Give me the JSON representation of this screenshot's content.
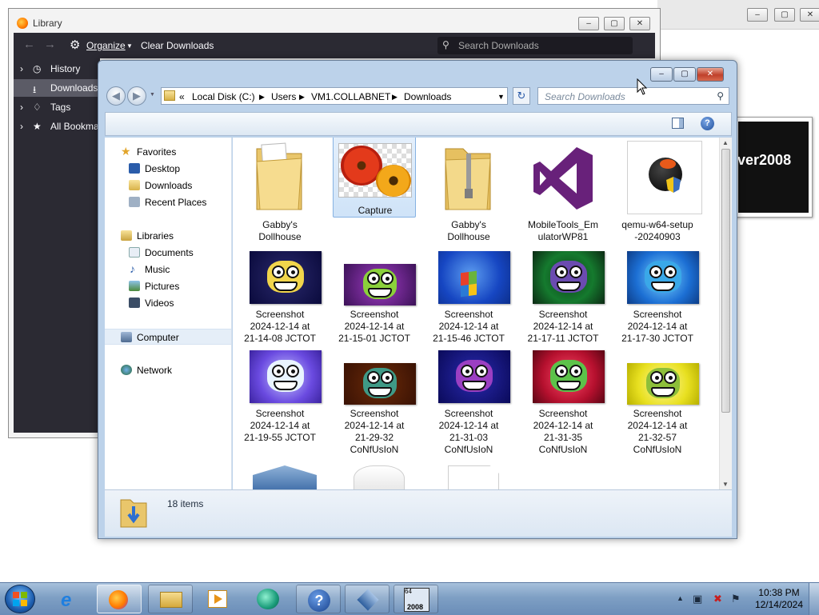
{
  "library": {
    "title": "Library",
    "organize": "Organize",
    "clear_downloads": "Clear Downloads",
    "search_placeholder": "Search Downloads",
    "tree": [
      "History",
      "Downloads",
      "Tags",
      "All Bookma"
    ]
  },
  "background_window": {
    "thumb_text": "rver2008"
  },
  "explorer": {
    "breadcrumb": [
      "Local Disk (C:)",
      "Users",
      "VM1.COLLABNET",
      "Downloads"
    ],
    "breadcrumb_prefix": "«",
    "search_placeholder": "Search Downloads",
    "nav": {
      "favorites": "Favorites",
      "desktop": "Desktop",
      "downloads": "Downloads",
      "recent": "Recent Places",
      "libraries": "Libraries",
      "documents": "Documents",
      "music": "Music",
      "pictures": "Pictures",
      "videos": "Videos",
      "computer": "Computer",
      "network": "Network"
    },
    "items": [
      "Gabby's\nDollhouse",
      "Capture",
      "Gabby's\nDollhouse",
      "MobileTools_Em\nulatorWP81",
      "qemu-w64-setup\n-20240903",
      "Screenshot\n2024-12-14 at\n21-14-08 JCTOT",
      "Screenshot\n2024-12-14 at\n21-15-01 JCTOT",
      "Screenshot\n2024-12-14 at\n21-15-46 JCTOT",
      "Screenshot\n2024-12-14 at\n21-17-11 JCTOT",
      "Screenshot\n2024-12-14 at\n21-17-30 JCTOT",
      "Screenshot\n2024-12-14 at\n21-19-55 JCTOT",
      "Screenshot\n2024-12-14 at\n21-29-32\nCoNfUsIoN",
      "Screenshot\n2024-12-14 at\n21-31-03\nCoNfUsIoN",
      "Screenshot\n2024-12-14 at\n21-31-35\nCoNfUsIoN",
      "Screenshot\n2024-12-14 at\n21-32-57\nCoNfUsIoN"
    ],
    "status_count": "18 items"
  },
  "taskbar": {
    "time": "10:38 PM",
    "date": "12/14/2024",
    "vbox_badge_top": "64",
    "vbox_badge_bottom": "2008"
  },
  "colors": {
    "explorer_frame": "#bcd2ea",
    "firefox_dark": "#2b2a33",
    "selection": "#cfe3f8"
  }
}
